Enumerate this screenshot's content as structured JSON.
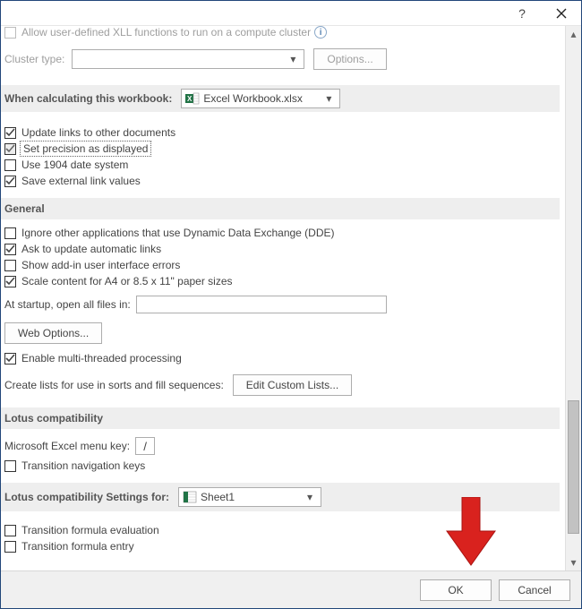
{
  "titlebar": {
    "help": "?",
    "close": "×"
  },
  "truncated_top": "Allow user-defined XLL functions to run on a compute cluster",
  "cluster": {
    "label": "Cluster type:",
    "value": "",
    "options_btn": "Options..."
  },
  "calc_workbook": {
    "label": "When calculating this workbook:",
    "value": "Excel Workbook.xlsx"
  },
  "calc_opts": {
    "update_links": "Update links to other documents",
    "precision": "Set precision as displayed",
    "date1904": "Use 1904 date system",
    "save_external": "Save external link values"
  },
  "general_header": "General",
  "general": {
    "ignore_dde": "Ignore other applications that use Dynamic Data Exchange (DDE)",
    "ask_update": "Ask to update automatic links",
    "show_addin_errors": "Show add-in user interface errors",
    "scale_content": "Scale content for A4 or 8.5 x 11\" paper sizes",
    "startup_label": "At startup, open all files in:",
    "startup_value": "",
    "web_options": "Web Options...",
    "enable_mt": "Enable multi-threaded processing",
    "create_lists_label": "Create lists for use in sorts and fill sequences:",
    "edit_custom_lists": "Edit Custom Lists..."
  },
  "lotus_header": "Lotus compatibility",
  "lotus": {
    "menu_key_label": "Microsoft Excel menu key:",
    "menu_key_value": "/",
    "transition_nav": "Transition navigation keys"
  },
  "lotus_settings_header": "Lotus compatibility Settings for:",
  "lotus_settings_sheet": "Sheet1",
  "lotus_settings": {
    "formula_eval": "Transition formula evaluation",
    "formula_entry": "Transition formula entry"
  },
  "footer": {
    "ok": "OK",
    "cancel": "Cancel"
  }
}
